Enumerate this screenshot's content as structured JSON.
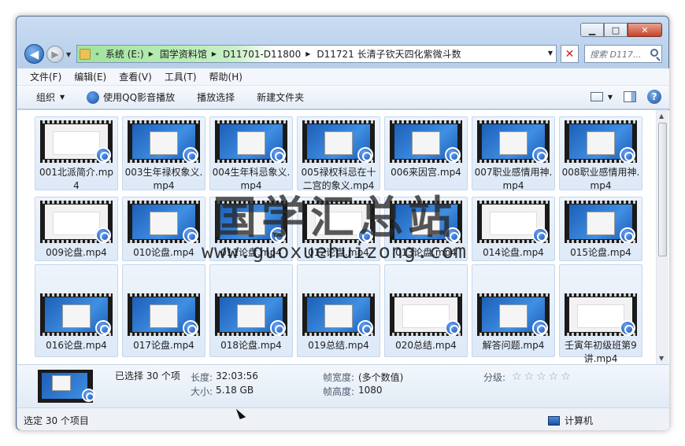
{
  "window": {
    "caption": {
      "minimize": "▁",
      "maximize": "□",
      "close": "✕"
    }
  },
  "nav": {
    "back_glyph": "◀",
    "forward_glyph": "▶",
    "history_glyph": "▼",
    "address_prefix": "«",
    "breadcrumbs": [
      "系统 (E:)",
      "国学资料馆",
      "D11701-D11800",
      "D11721 长清子钦天四化紫微斗数"
    ],
    "breadcrumb_sep": "▶",
    "address_drop": "▼",
    "refresh_glyph": "✕",
    "search_placeholder": "搜索 D117..."
  },
  "menubar": {
    "items": [
      "文件(F)",
      "编辑(E)",
      "查看(V)",
      "工具(T)",
      "帮助(H)"
    ]
  },
  "toolbar": {
    "organize": "组织",
    "play_qq": "使用QQ影音播放",
    "play_select": "播放选择",
    "new_folder": "新建文件夹",
    "dropdown_glyph": "▼",
    "help_glyph": "?"
  },
  "files": [
    {
      "name": "001北派简介.mp4",
      "thumb": "doc"
    },
    {
      "name": "003生年禄权象义.mp4",
      "thumb": "desk"
    },
    {
      "name": "004生年科忌象义.mp4",
      "thumb": "desk"
    },
    {
      "name": "005禄权科忌在十二宫的象义.mp4",
      "thumb": "desk"
    },
    {
      "name": "006来因宫.mp4",
      "thumb": "desk"
    },
    {
      "name": "007职业感情用神.mp4",
      "thumb": "desk"
    },
    {
      "name": "008职业感情用神.mp4",
      "thumb": "desk"
    },
    {
      "name": "009论盘.mp4",
      "thumb": "doc"
    },
    {
      "name": "010论盘.mp4",
      "thumb": "desk"
    },
    {
      "name": "011论盘.mp4",
      "thumb": "desk"
    },
    {
      "name": "012论盘.mp4",
      "thumb": "doc"
    },
    {
      "name": "013论盘.mp4",
      "thumb": "desk"
    },
    {
      "name": "014论盘.mp4",
      "thumb": "doc"
    },
    {
      "name": "015论盘.mp4",
      "thumb": "desk"
    },
    {
      "name": "016论盘.mp4",
      "thumb": "desk"
    },
    {
      "name": "017论盘.mp4",
      "thumb": "desk"
    },
    {
      "name": "018论盘.mp4",
      "thumb": "desk"
    },
    {
      "name": "019总结.mp4",
      "thumb": "desk"
    },
    {
      "name": "020总结.mp4",
      "thumb": "doc"
    },
    {
      "name": "解答问题.mp4",
      "thumb": "desk"
    },
    {
      "name": "壬寅年初级班第9讲.mp4",
      "thumb": "doc"
    }
  ],
  "scroll": {
    "up": "▲",
    "down": "▼"
  },
  "details": {
    "selected": "已选择 30 个项",
    "length_label": "长度:",
    "length_value": "32:03:56",
    "size_label": "大小:",
    "size_value": "5.18 GB",
    "frame_width_label": "帧宽度:",
    "frame_width_value": "(多个数值)",
    "frame_height_label": "帧高度:",
    "frame_height_value": "1080",
    "rating_label": "分级:",
    "rating_stars": "☆☆☆☆☆"
  },
  "status": {
    "left": "选定 30 个项目",
    "right": "计算机"
  },
  "watermark": {
    "cn": "国学汇总站",
    "url": "www.guoxuehuizong.com"
  }
}
